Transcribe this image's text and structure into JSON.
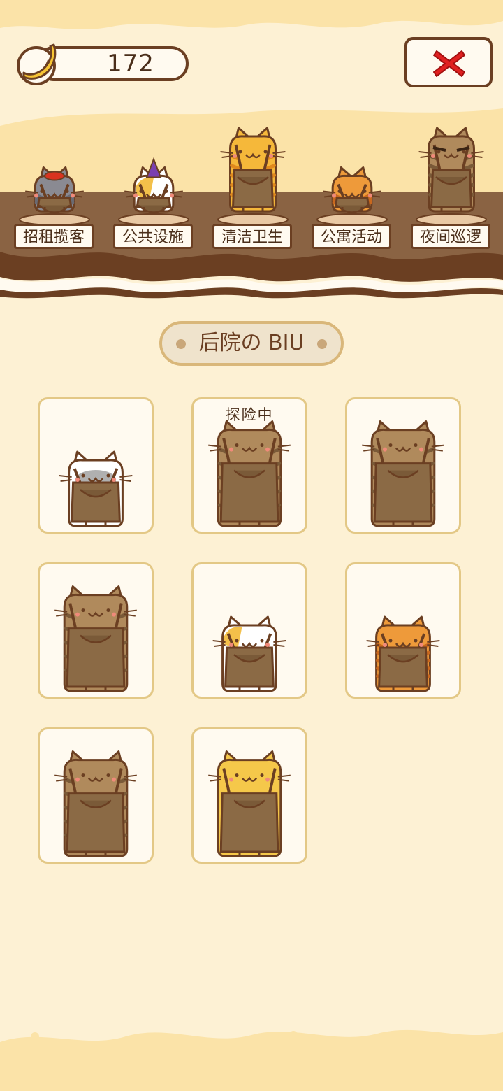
{
  "currency": {
    "amount": "172",
    "icon": "banana-icon"
  },
  "close_button": {
    "icon": "close-x-icon",
    "color": "#e02020"
  },
  "jobs": [
    {
      "label": "招租揽客",
      "cat": "gray-red-beret"
    },
    {
      "label": "公共设施",
      "cat": "calico-party-hat"
    },
    {
      "label": "清洁卫生",
      "cat": "yellow-striped"
    },
    {
      "label": "公寓活动",
      "cat": "orange-tabby"
    },
    {
      "label": "夜间巡逻",
      "cat": "brown-tabby-glasses"
    }
  ],
  "section": {
    "title": "后院の BIU"
  },
  "cats": [
    {
      "status": "",
      "type": "gray-white"
    },
    {
      "status": "探险中",
      "type": "brown-tabby"
    },
    {
      "status": "",
      "type": "brown-tabby"
    },
    {
      "status": "",
      "type": "brown-tabby"
    },
    {
      "status": "",
      "type": "calico"
    },
    {
      "status": "",
      "type": "orange-tabby"
    },
    {
      "status": "",
      "type": "brown-tabby"
    },
    {
      "status": "",
      "type": "yellow"
    }
  ],
  "colors": {
    "background": "#fdf1d4",
    "outline": "#6b3f22",
    "card_border": "#e3c886",
    "shelf": "#8a6343"
  }
}
